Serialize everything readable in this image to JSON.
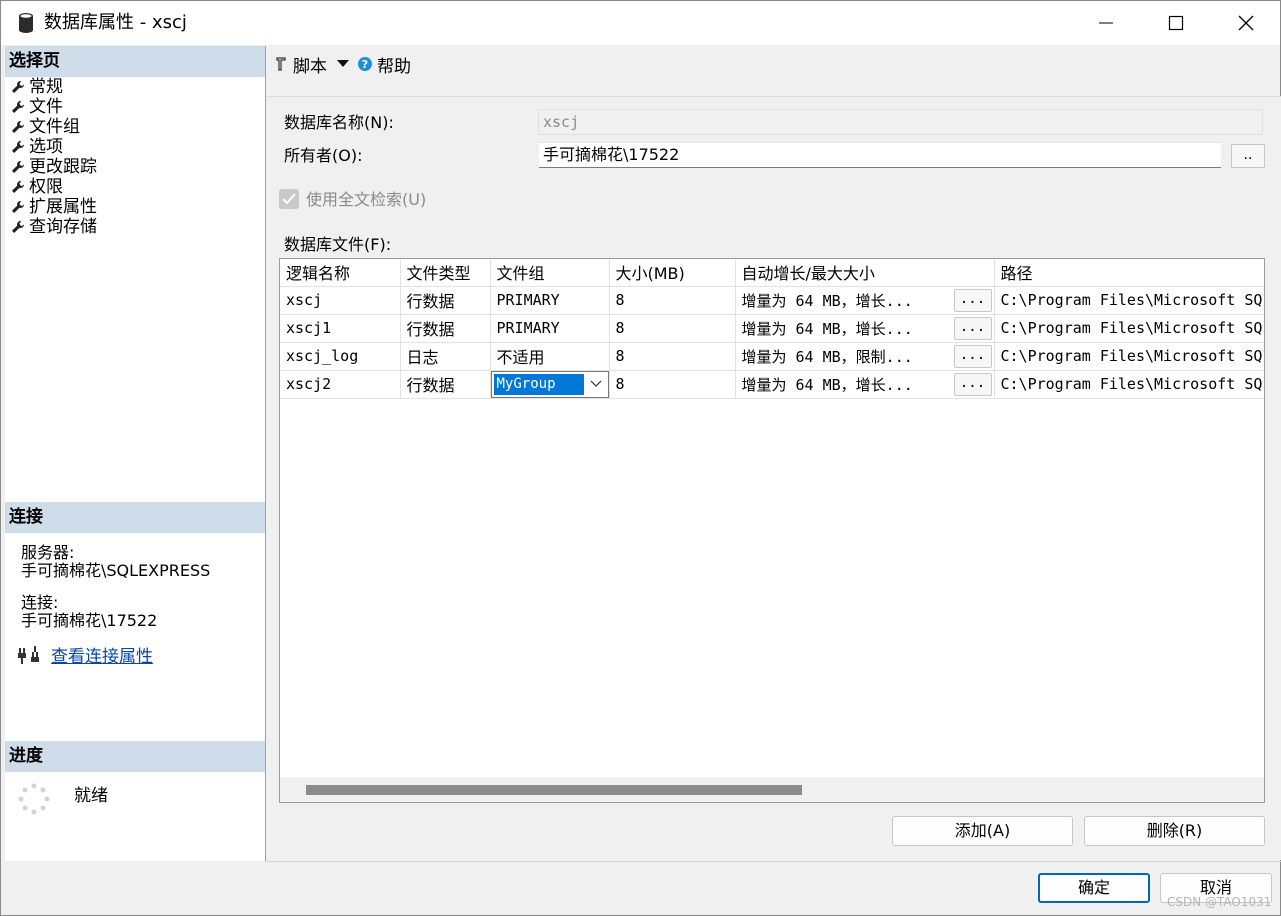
{
  "window": {
    "title": "数据库属性 - xscj",
    "minimize_icon": "minimize-icon",
    "maximize_icon": "maximize-icon",
    "close_icon": "close-icon"
  },
  "left": {
    "select_page_header": "选择页",
    "pages": [
      "常规",
      "文件",
      "文件组",
      "选项",
      "更改跟踪",
      "权限",
      "扩展属性",
      "查询存储"
    ],
    "connection_header": "连接",
    "server_label": "服务器:",
    "server_value": "手可摘棉花\\SQLEXPRESS",
    "connection_label": "连接:",
    "connection_value": "手可摘棉花\\17522",
    "view_connection_link": "查看连接属性",
    "progress_header": "进度",
    "progress_status": "就绪"
  },
  "toolbar": {
    "script_label": "脚本",
    "help_label": "帮助"
  },
  "form": {
    "db_name_label": "数据库名称(N):",
    "db_name_value": "xscj",
    "owner_label": "所有者(O):",
    "owner_value": "手可摘棉花\\17522",
    "owner_browse": "..",
    "fulltext_label": "使用全文检索(U)",
    "fulltext_checked": true,
    "db_files_label": "数据库文件(F):"
  },
  "grid": {
    "columns": [
      "逻辑名称",
      "文件类型",
      "文件组",
      "大小(MB)",
      "自动增长/最大大小",
      "路径"
    ],
    "rows": [
      {
        "name": "xscj",
        "type": "行数据",
        "filegroup": "PRIMARY",
        "size": "8",
        "growth": "增量为 64 MB，增长...",
        "path": "C:\\Program Files\\Microsoft SQ"
      },
      {
        "name": "xscj1",
        "type": "行数据",
        "filegroup": "PRIMARY",
        "size": "8",
        "growth": "增量为 64 MB，增长...",
        "path": "C:\\Program Files\\Microsoft SQ"
      },
      {
        "name": "xscj_log",
        "type": "日志",
        "filegroup": "不适用",
        "size": "8",
        "growth": "增量为 64 MB，限制...",
        "path": "C:\\Program Files\\Microsoft SQ"
      },
      {
        "name": "xscj2",
        "type": "行数据",
        "filegroup": "MyGroup",
        "size": "8",
        "growth": "增量为 64 MB，增长...",
        "path": "C:\\Program Files\\Microsoft SQ"
      }
    ],
    "ellipsis": "..."
  },
  "buttons": {
    "add": "添加(A)",
    "remove": "删除(R)",
    "ok": "确定",
    "cancel": "取消"
  },
  "watermark": "CSDN @TAO1031",
  "colors": {
    "header_bg": "#cfdcea",
    "selection": "#0078d7",
    "link": "#0645ad",
    "help_icon": "#1c8fd6"
  }
}
